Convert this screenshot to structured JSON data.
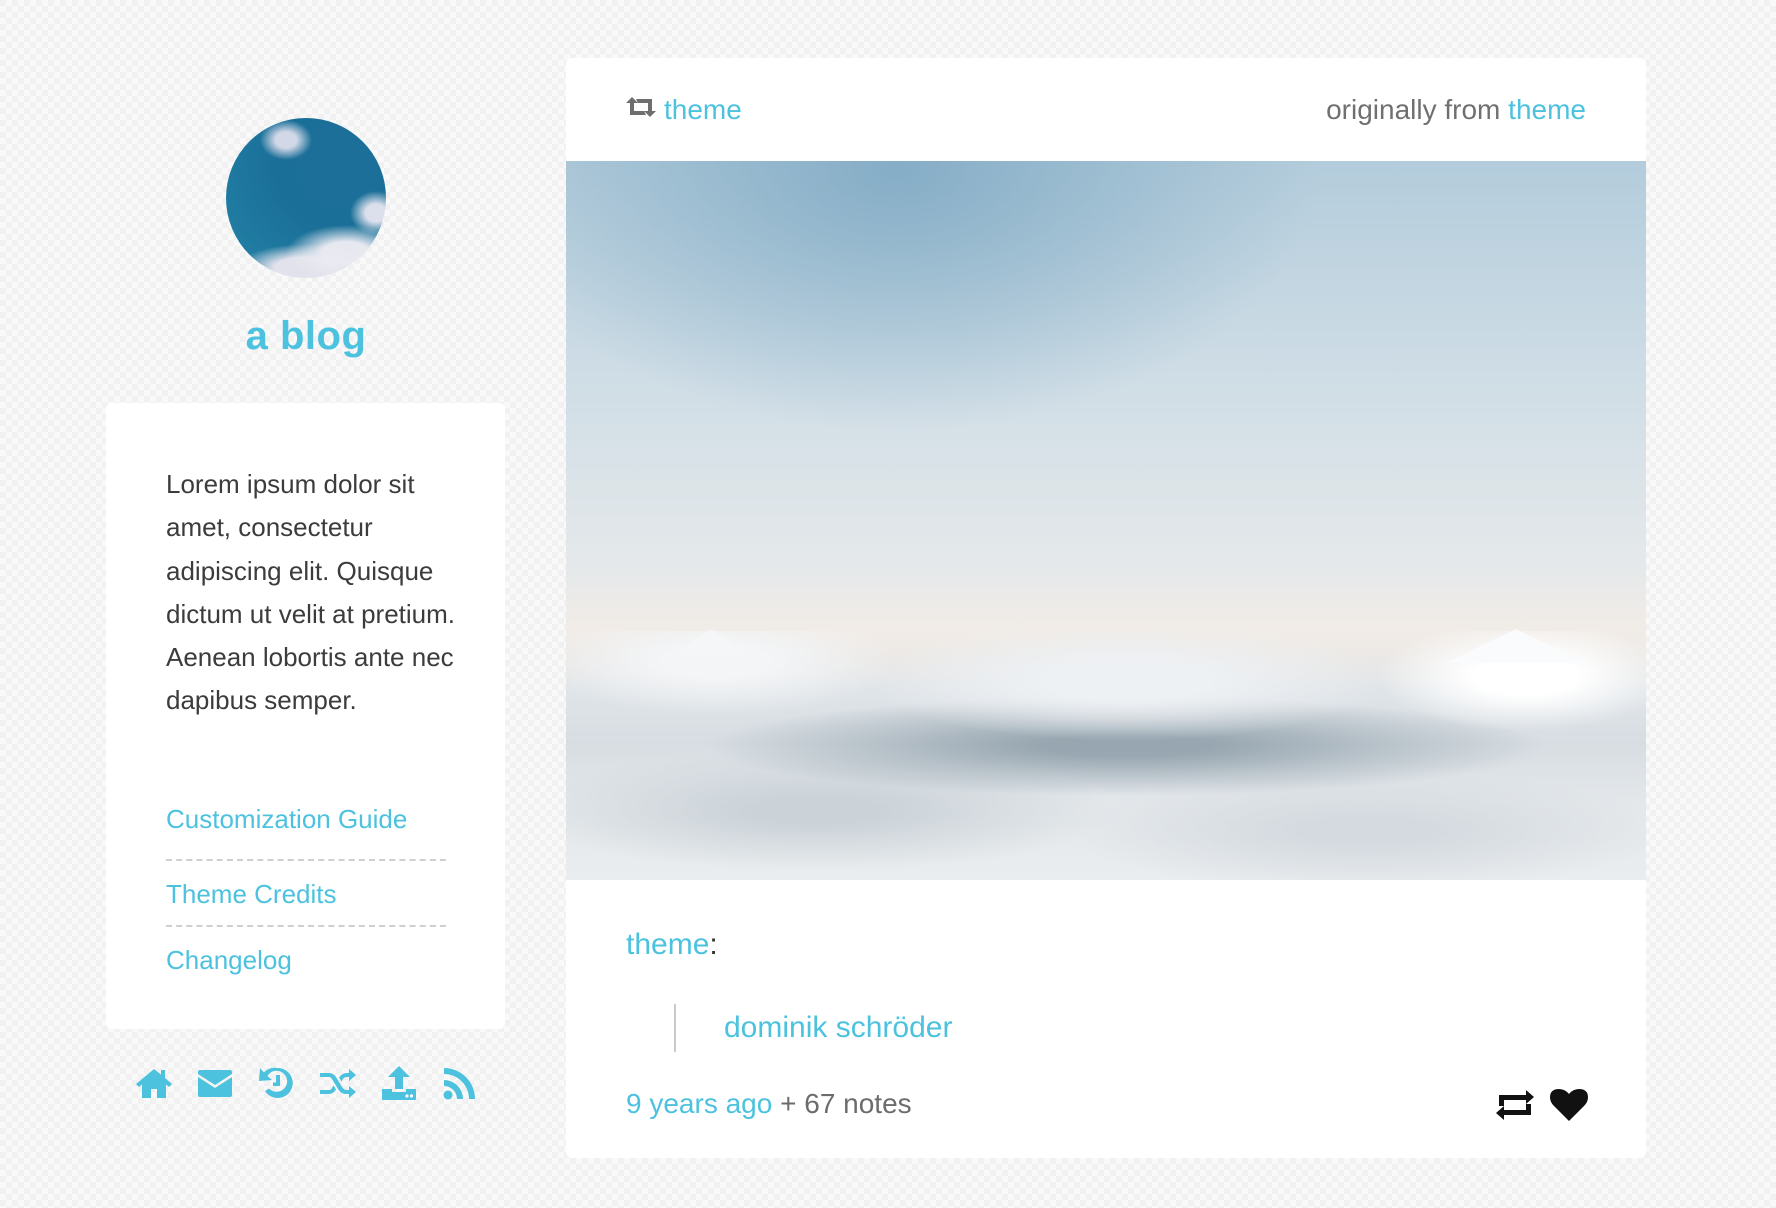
{
  "sidebar": {
    "avatar_alt": "blog avatar (sky with clouds)",
    "title": "a blog",
    "description": "Lorem ipsum dolor sit amet, consectetur adipiscing elit. Quisque dictum ut velit at pretium. Aenean lobortis ante nec dapibus semper.",
    "links": [
      {
        "label": "Customization Guide"
      },
      {
        "label": "Theme Credits"
      },
      {
        "label": "Changelog"
      }
    ],
    "nav_icons": [
      {
        "icon": "home-icon",
        "label": "Home"
      },
      {
        "icon": "mail-icon",
        "label": "Ask / Message"
      },
      {
        "icon": "history-icon",
        "label": "Archive"
      },
      {
        "icon": "shuffle-icon",
        "label": "Random"
      },
      {
        "icon": "upload-icon",
        "label": "Submit"
      },
      {
        "icon": "rss-icon",
        "label": "RSS"
      }
    ]
  },
  "post": {
    "reblogged_from": "theme",
    "originally_from_prefix": "originally from",
    "originally_from": "theme",
    "image_alt": "sea of clouds with snowy mountain peaks",
    "source_user": "theme",
    "source_colon": ":",
    "quote_text": "dominik schröder",
    "timestamp": "9 years ago",
    "notes": "+ 67 notes",
    "actions": [
      {
        "icon": "reblog-icon"
      },
      {
        "icon": "heart-icon"
      }
    ]
  },
  "colors": {
    "accent": "#4cc2df",
    "text": "#3c3c3c",
    "muted": "#707070",
    "background": "#f1f1f1"
  }
}
